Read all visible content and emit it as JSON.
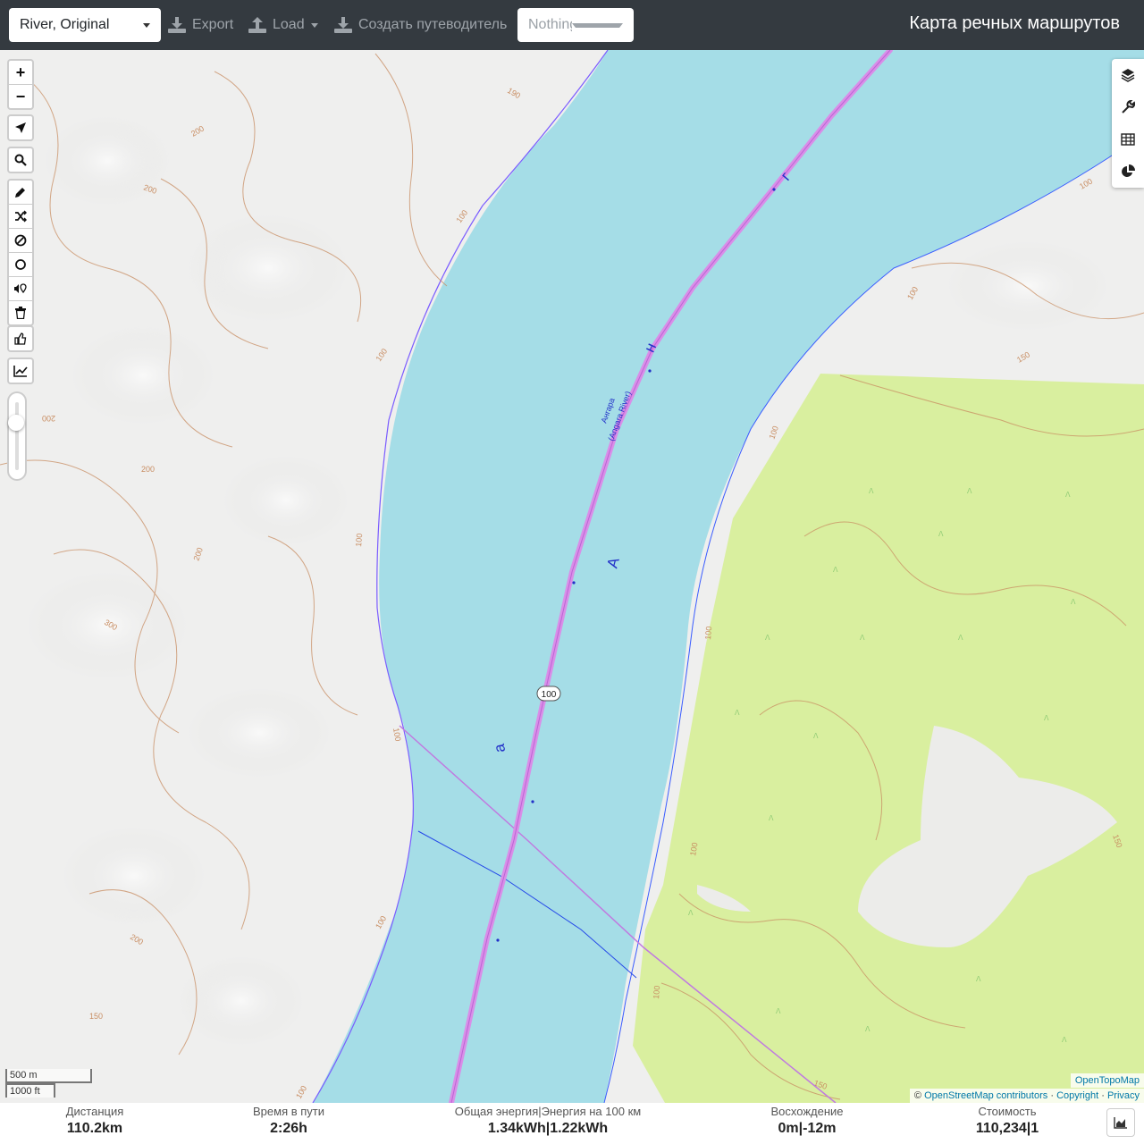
{
  "header": {
    "profile_select": "River, Original",
    "export_label": "Export",
    "load_label": "Load",
    "guide_label": "Создать путеводитель",
    "filter_placeholder": "Nothing selected",
    "brand_title": "Карта речных маршрутов"
  },
  "map": {
    "river_name": "Ангара",
    "river_name_en": "(Angara River)",
    "river_letters": [
      "А",
      "н",
      "г",
      "а"
    ],
    "route_shield": "100",
    "contours": [
      "190",
      "200",
      "200",
      "100",
      "100",
      "200",
      "200",
      "100",
      "200",
      "300",
      "200",
      "100",
      "100",
      "200",
      "150",
      "100",
      "100",
      "150",
      "100",
      "100",
      "100",
      "100",
      "150",
      "100",
      "150"
    ],
    "scale_metric": "500 m",
    "scale_imperial": "1000 ft",
    "tile_credit": "OpenTopoMap",
    "attribution_prefix": "©",
    "attribution_osm": "OpenStreetMap contributors",
    "attribution_sep1": "·",
    "attribution_copyright": "Copyright",
    "attribution_sep2": "·",
    "attribution_privacy": "Privacy",
    "colors": {
      "water": "#a5dde7",
      "forest": "#d9ef9f",
      "route": "#d98ee8",
      "contour": "#c88d62",
      "header": "#343a40"
    }
  },
  "controls": {
    "zoom_in": "+",
    "zoom_out": "−",
    "left_icons": [
      "locate-icon",
      "search-icon",
      "pencil-icon",
      "shuffle-icon",
      "forbidden-icon",
      "circle-icon",
      "sound-pin-icon",
      "trash-icon",
      "thumb-icon",
      "chart-line-icon"
    ],
    "right_icons": [
      "layers-icon",
      "wrench-icon",
      "table-icon",
      "pie-chart-icon"
    ]
  },
  "stats": {
    "distance_label": "Дистанция",
    "distance_value": "110.2km",
    "time_label": "Время в пути",
    "time_value": "2:26h",
    "energy_label": "Общая энергия|Энергия на 100 км",
    "energy_value": "1.34kWh|1.22kWh",
    "ascent_label": "Восхождение",
    "ascent_value": "0m|-12m",
    "cost_label": "Стоимость",
    "cost_value": "110,234|1"
  }
}
